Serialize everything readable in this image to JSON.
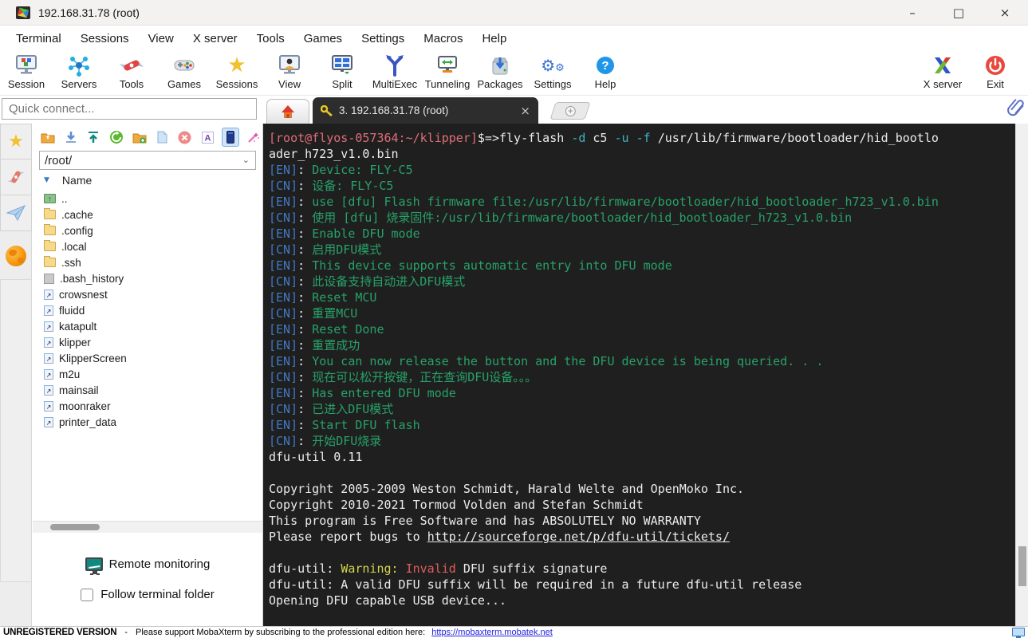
{
  "window": {
    "title": "192.168.31.78 (root)",
    "controls": {
      "minimize": "–",
      "maximize": "□",
      "close": "×"
    }
  },
  "menubar": {
    "items": [
      "Terminal",
      "Sessions",
      "View",
      "X server",
      "Tools",
      "Games",
      "Settings",
      "Macros",
      "Help"
    ]
  },
  "toolbar": {
    "items": [
      {
        "label": "Session",
        "icon": "session-icon"
      },
      {
        "label": "Servers",
        "icon": "servers-icon"
      },
      {
        "label": "Tools",
        "icon": "tools-icon"
      },
      {
        "label": "Games",
        "icon": "games-icon"
      },
      {
        "label": "Sessions",
        "icon": "sessions-star-icon"
      },
      {
        "label": "View",
        "icon": "view-icon"
      },
      {
        "label": "Split",
        "icon": "split-icon"
      },
      {
        "label": "MultiExec",
        "icon": "multiexec-icon"
      },
      {
        "label": "Tunneling",
        "icon": "tunneling-icon"
      },
      {
        "label": "Packages",
        "icon": "packages-icon"
      },
      {
        "label": "Settings",
        "icon": "settings-gear-icon"
      },
      {
        "label": "Help",
        "icon": "help-icon"
      }
    ],
    "right_items": [
      {
        "label": "X server",
        "icon": "xserver-icon"
      },
      {
        "label": "Exit",
        "icon": "exit-icon"
      }
    ]
  },
  "tabbar": {
    "quick_connect_placeholder": "Quick connect...",
    "active_tab_label": "3. 192.168.31.78 (root)",
    "close_glyph": "×",
    "new_tab_glyph": "+"
  },
  "file_panel": {
    "path": "/root/",
    "column_header": "Name",
    "files": [
      {
        "name": "..",
        "icon": "updir"
      },
      {
        "name": ".cache",
        "icon": "folder"
      },
      {
        "name": ".config",
        "icon": "folder"
      },
      {
        "name": ".local",
        "icon": "folder"
      },
      {
        "name": ".ssh",
        "icon": "folder"
      },
      {
        "name": ".bash_history",
        "icon": "gfile"
      },
      {
        "name": "crowsnest",
        "icon": "symlink"
      },
      {
        "name": "fluidd",
        "icon": "symlink"
      },
      {
        "name": "katapult",
        "icon": "symlink"
      },
      {
        "name": "klipper",
        "icon": "symlink"
      },
      {
        "name": "KlipperScreen",
        "icon": "symlink"
      },
      {
        "name": "m2u",
        "icon": "symlink"
      },
      {
        "name": "mainsail",
        "icon": "symlink"
      },
      {
        "name": "moonraker",
        "icon": "symlink"
      },
      {
        "name": "printer_data",
        "icon": "symlink"
      }
    ],
    "remote_monitoring_label": "Remote monitoring",
    "follow_checkbox_label": "Follow terminal folder",
    "follow_checkbox_checked": false
  },
  "terminal": {
    "lines": [
      [
        {
          "t": "[root@flyos-057364:~/klipper]",
          "c": "prompt"
        },
        {
          "t": "$=>",
          "c": "def"
        },
        {
          "t": "fly-flash ",
          "c": "def"
        },
        {
          "t": "-d ",
          "c": "cyan"
        },
        {
          "t": "c5 ",
          "c": "def"
        },
        {
          "t": "-u ",
          "c": "cyan"
        },
        {
          "t": "-f ",
          "c": "cyan"
        },
        {
          "t": "/usr/lib/firmware/bootloader/hid_bootlo",
          "c": "def"
        }
      ],
      [
        {
          "t": "ader_h723_v1.0.bin",
          "c": "def"
        }
      ],
      [
        {
          "t": "[EN]",
          "c": "blue"
        },
        {
          "t": ": ",
          "c": "def"
        },
        {
          "t": "Device: FLY-C5",
          "c": "green"
        }
      ],
      [
        {
          "t": "[CN]",
          "c": "blue"
        },
        {
          "t": ": ",
          "c": "def"
        },
        {
          "t": "设备: FLY-C5",
          "c": "green"
        }
      ],
      [
        {
          "t": "[EN]",
          "c": "blue"
        },
        {
          "t": ": ",
          "c": "def"
        },
        {
          "t": "use [dfu] Flash firmware file:/usr/lib/firmware/bootloader/hid_bootloader_h723_v1.0.bin",
          "c": "green"
        }
      ],
      [
        {
          "t": "[CN]",
          "c": "blue"
        },
        {
          "t": ": ",
          "c": "def"
        },
        {
          "t": "使用 [dfu] 烧录固件:/usr/lib/firmware/bootloader/hid_bootloader_h723_v1.0.bin",
          "c": "green"
        }
      ],
      [
        {
          "t": "[EN]",
          "c": "blue"
        },
        {
          "t": ": ",
          "c": "def"
        },
        {
          "t": "Enable DFU mode",
          "c": "green"
        }
      ],
      [
        {
          "t": "[CN]",
          "c": "blue"
        },
        {
          "t": ": ",
          "c": "def"
        },
        {
          "t": "启用DFU模式",
          "c": "green"
        }
      ],
      [
        {
          "t": "[EN]",
          "c": "blue"
        },
        {
          "t": ": ",
          "c": "def"
        },
        {
          "t": "This device supports automatic entry into DFU mode",
          "c": "green"
        }
      ],
      [
        {
          "t": "[CN]",
          "c": "blue"
        },
        {
          "t": ": ",
          "c": "def"
        },
        {
          "t": "此设备支持自动进入DFU模式",
          "c": "green"
        }
      ],
      [
        {
          "t": "[EN]",
          "c": "blue"
        },
        {
          "t": ": ",
          "c": "def"
        },
        {
          "t": "Reset MCU",
          "c": "green"
        }
      ],
      [
        {
          "t": "[CN]",
          "c": "blue"
        },
        {
          "t": ": ",
          "c": "def"
        },
        {
          "t": "重置MCU",
          "c": "green"
        }
      ],
      [
        {
          "t": "[EN]",
          "c": "blue"
        },
        {
          "t": ": ",
          "c": "def"
        },
        {
          "t": "Reset Done",
          "c": "green"
        }
      ],
      [
        {
          "t": "[EN]",
          "c": "blue"
        },
        {
          "t": ": ",
          "c": "def"
        },
        {
          "t": "重置成功",
          "c": "green"
        }
      ],
      [
        {
          "t": "[EN]",
          "c": "blue"
        },
        {
          "t": ": ",
          "c": "def"
        },
        {
          "t": "You can now release the button and the DFU device is being queried. . .",
          "c": "green"
        }
      ],
      [
        {
          "t": "[CN]",
          "c": "blue"
        },
        {
          "t": ": ",
          "c": "def"
        },
        {
          "t": "现在可以松开按键，正在查询DFU设备。。。",
          "c": "green"
        }
      ],
      [
        {
          "t": "[EN]",
          "c": "blue"
        },
        {
          "t": ": ",
          "c": "def"
        },
        {
          "t": "Has entered DFU mode",
          "c": "green"
        }
      ],
      [
        {
          "t": "[CN]",
          "c": "blue"
        },
        {
          "t": ": ",
          "c": "def"
        },
        {
          "t": "已进入DFU模式",
          "c": "green"
        }
      ],
      [
        {
          "t": "[EN]",
          "c": "blue"
        },
        {
          "t": ": ",
          "c": "def"
        },
        {
          "t": "Start DFU flash",
          "c": "green"
        }
      ],
      [
        {
          "t": "[CN]",
          "c": "blue"
        },
        {
          "t": ": ",
          "c": "def"
        },
        {
          "t": "开始DFU烧录",
          "c": "green"
        }
      ],
      [
        {
          "t": "dfu-util 0.11",
          "c": "def"
        }
      ],
      [],
      [
        {
          "t": "Copyright 2005-2009 Weston Schmidt, Harald Welte and OpenMoko Inc.",
          "c": "def"
        }
      ],
      [
        {
          "t": "Copyright 2010-2021 Tormod Volden and Stefan Schmidt",
          "c": "def"
        }
      ],
      [
        {
          "t": "This program is Free Software and has ABSOLUTELY NO WARRANTY",
          "c": "def"
        }
      ],
      [
        {
          "t": "Please report bugs to ",
          "c": "def"
        },
        {
          "t": "http://sourceforge.net/p/dfu-util/tickets/",
          "c": "link"
        }
      ],
      [],
      [
        {
          "t": "dfu-util: ",
          "c": "def"
        },
        {
          "t": "Warning:",
          "c": "yellow"
        },
        {
          "t": " ",
          "c": "def"
        },
        {
          "t": "Invalid",
          "c": "red"
        },
        {
          "t": " DFU suffix signature",
          "c": "def"
        }
      ],
      [
        {
          "t": "dfu-util: A valid DFU suffix will be required in a future dfu-util release",
          "c": "def"
        }
      ],
      [
        {
          "t": "Opening DFU capable USB device...",
          "c": "def"
        }
      ]
    ]
  },
  "statusbar": {
    "version": "UNREGISTERED VERSION",
    "separator": "-",
    "message": "Please support MobaXterm by subscribing to the professional edition here:",
    "link": "https://mobaxterm.mobatek.net"
  },
  "colors": {
    "terminal_bg": "#1f1f1f",
    "terminal_default": "#ececec",
    "terminal_prompt_pink": "#df6e78",
    "terminal_label_blue": "#3f7ac4",
    "terminal_message_green": "#27a269",
    "terminal_flag_cyan": "#3fb3c6",
    "terminal_warning_yellow": "#d4d44e",
    "terminal_error_red": "#e25d5d",
    "active_tab_bg": "#2d2d2d",
    "statusbar_link_blue": "#2222dd",
    "selected_tool_bg": "#cfe4f7"
  }
}
